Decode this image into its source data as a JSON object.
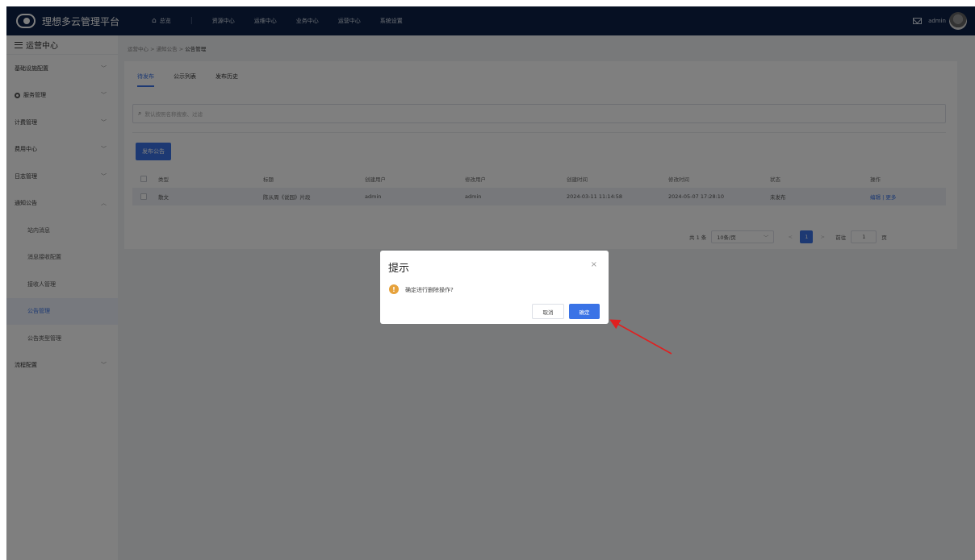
{
  "topbar": {
    "app_name": "理想多云管理平台",
    "nav": [
      "总览",
      "资源中心",
      "运维中心",
      "业务中心",
      "运营中心",
      "系统设置"
    ],
    "user": "admin"
  },
  "sidebar": {
    "title": "运营中心",
    "items": [
      {
        "label": "基础设施配置",
        "chevron": "﹀"
      },
      {
        "label": "服务管理",
        "chevron": "﹀"
      },
      {
        "label": "计费管理",
        "chevron": "﹀"
      },
      {
        "label": "费用中心",
        "chevron": "﹀"
      },
      {
        "label": "日志管理",
        "chevron": "﹀"
      },
      {
        "label": "通知公告",
        "chevron": "︿"
      },
      {
        "label": "站内消息"
      },
      {
        "label": "消息接收配置"
      },
      {
        "label": "接收人管理"
      },
      {
        "label": "公告管理"
      },
      {
        "label": "公告类型管理"
      },
      {
        "label": "流程配置",
        "chevron": "﹀"
      }
    ]
  },
  "breadcrumb": {
    "parts": [
      "运营中心",
      "通知公告"
    ],
    "current": "公告管理",
    "sep": ">"
  },
  "tabs": [
    "待发布",
    "公示列表",
    "发布历史"
  ],
  "search": {
    "placeholder": "默认按照名称搜索、过滤"
  },
  "publish_button": "发布公告",
  "table": {
    "headers": [
      "类型",
      "标题",
      "创建用户",
      "修改用户",
      "创建时间",
      "修改时间",
      "状态",
      "操作"
    ],
    "rows": [
      {
        "type": "散文",
        "title": "陈从周《说园》片段",
        "creator": "admin",
        "modifier": "admin",
        "created": "2024-03-11 11:14:58",
        "modified": "2024-05-07 17:28:10",
        "status": "未发布",
        "edit": "编辑",
        "sep": "|",
        "more": "更多"
      }
    ]
  },
  "pagination": {
    "total": "共 1 条",
    "page_size": "10条/页",
    "current": "1",
    "goto_label": "前往",
    "goto_value": "1",
    "page_unit": "页"
  },
  "dialog": {
    "title": "提示",
    "message": "确定进行删除操作?",
    "cancel": "取消",
    "confirm": "确定",
    "close": "×"
  },
  "colors": {
    "primary": "#3a73e6",
    "topbar": "#0d2147",
    "warning": "#e6a23c",
    "annotation_arrow": "#e02020"
  }
}
